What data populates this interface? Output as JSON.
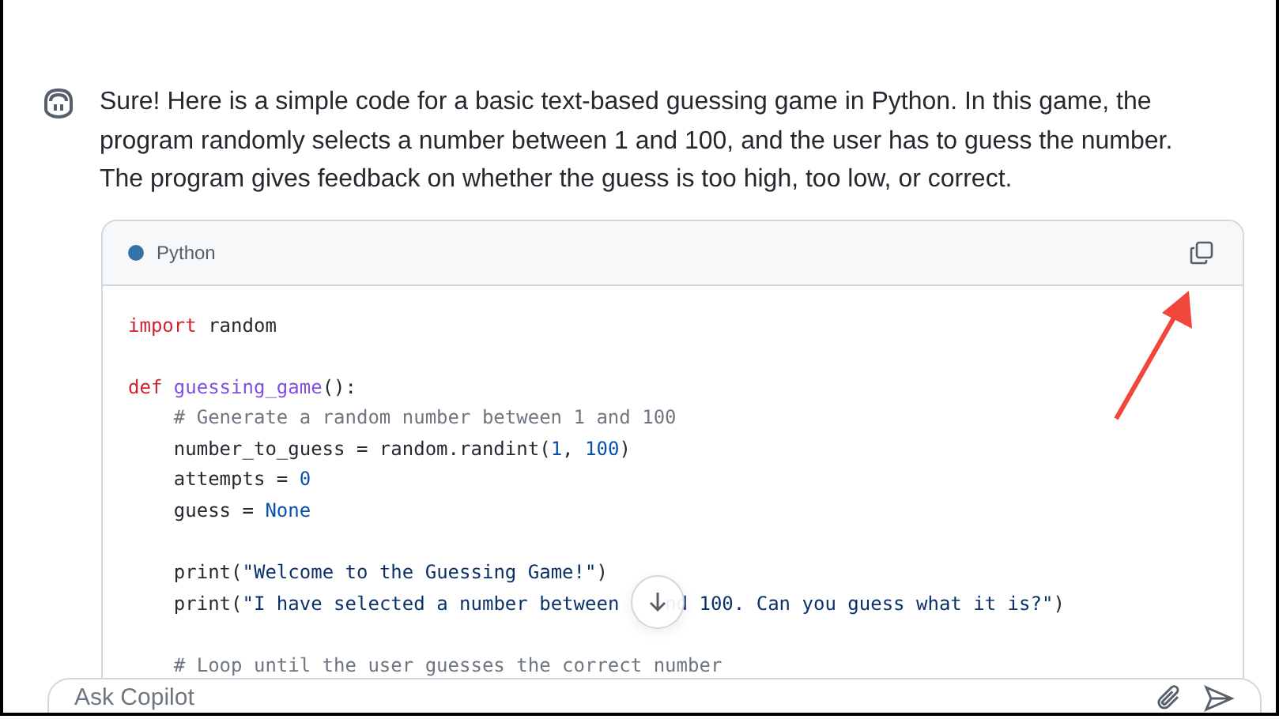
{
  "message": {
    "text": "Sure! Here is a simple code for a basic text-based guessing game in Python. In this game, the program randomly selects a number between 1 and 100, and the user has to guess the number. The program gives feedback on whether the guess is too high, too low, or correct."
  },
  "code_block": {
    "language": "Python",
    "lines": [
      {
        "kind": "code",
        "indented": false,
        "tokens": [
          {
            "kind": "keyword",
            "text": "import"
          },
          {
            "kind": "plain",
            "text": " random"
          }
        ]
      },
      {
        "kind": "blank"
      },
      {
        "kind": "code",
        "indented": false,
        "tokens": [
          {
            "kind": "keyword",
            "text": "def "
          },
          {
            "kind": "function",
            "text": "guessing_game"
          },
          {
            "kind": "plain",
            "text": "():"
          }
        ]
      },
      {
        "kind": "code",
        "indented": true,
        "tokens": [
          {
            "kind": "comment",
            "text": "# Generate a random number between 1 and 100"
          }
        ]
      },
      {
        "kind": "code",
        "indented": true,
        "tokens": [
          {
            "kind": "plain",
            "text": "number_to_guess = random.randint("
          },
          {
            "kind": "number",
            "text": "1"
          },
          {
            "kind": "plain",
            "text": ", "
          },
          {
            "kind": "number",
            "text": "100"
          },
          {
            "kind": "plain",
            "text": ")"
          }
        ]
      },
      {
        "kind": "code",
        "indented": true,
        "tokens": [
          {
            "kind": "plain",
            "text": "attempts = "
          },
          {
            "kind": "number",
            "text": "0"
          }
        ]
      },
      {
        "kind": "code",
        "indented": true,
        "tokens": [
          {
            "kind": "plain",
            "text": "guess = "
          },
          {
            "kind": "number",
            "text": "None"
          }
        ]
      },
      {
        "kind": "blank"
      },
      {
        "kind": "code",
        "indented": true,
        "tokens": [
          {
            "kind": "plain",
            "text": "print("
          },
          {
            "kind": "string",
            "text": "\"Welcome to the Guessing Game!\""
          },
          {
            "kind": "plain",
            "text": ")"
          }
        ]
      },
      {
        "kind": "code",
        "indented": true,
        "tokens": [
          {
            "kind": "plain",
            "text": "print("
          },
          {
            "kind": "string",
            "text": "\"I have selected a number between"
          },
          {
            "kind": "string",
            "text": "nd 100. Can you guess what it is?\"",
            "hidden_before": true
          },
          {
            "kind": "plain",
            "text": ")"
          }
        ]
      },
      {
        "kind": "blank"
      },
      {
        "kind": "code",
        "indented": true,
        "tokens": [
          {
            "kind": "comment",
            "text": "# Loop until the user guesses the correct number"
          }
        ]
      }
    ]
  },
  "composer": {
    "placeholder": "Ask Copilot"
  }
}
